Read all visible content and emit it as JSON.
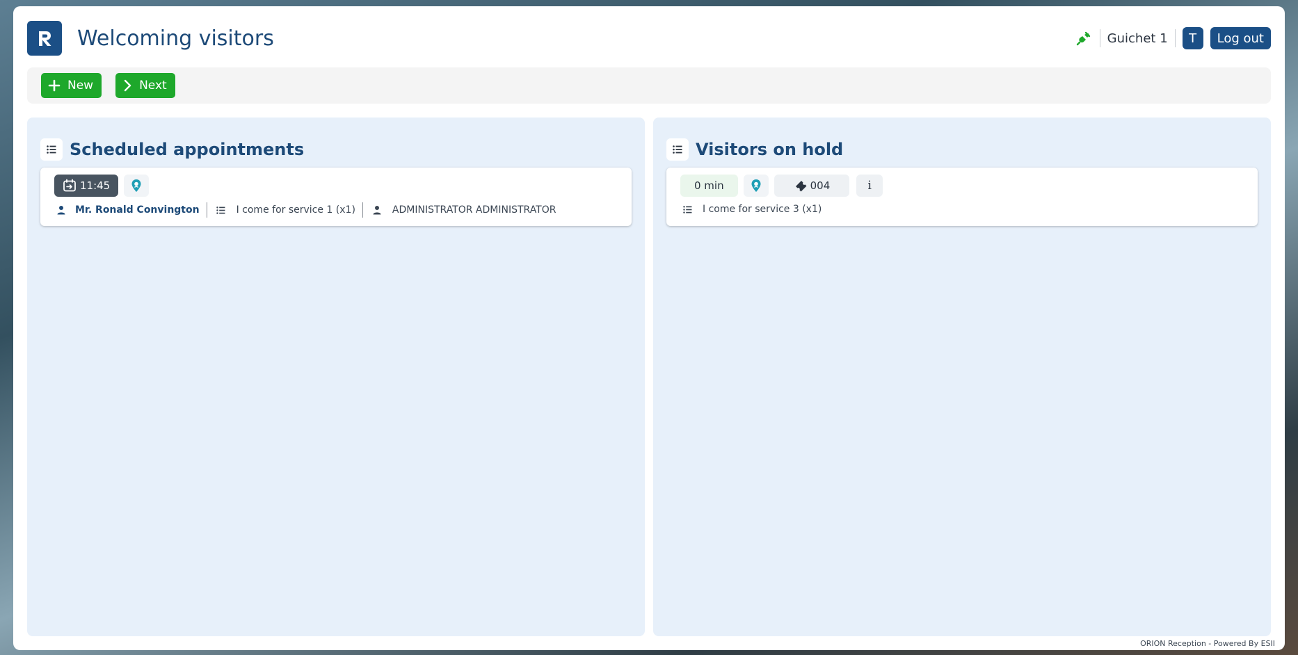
{
  "app": {
    "title": "Welcoming visitors",
    "logo_letter": "R",
    "brand_color": "#1b4f86",
    "accent_green": "#1ea82b"
  },
  "header": {
    "connection_icon": "plug-connected-icon",
    "counter_label": "Guichet 1",
    "user_initial": "T",
    "logout_label": "Log out"
  },
  "toolbar": {
    "new_label": "New",
    "next_label": "Next"
  },
  "scheduled": {
    "title": "Scheduled appointments",
    "appointments": [
      {
        "time": "11:45",
        "visitor": "Mr. Ronald Convington",
        "service": "I come for service 1  (x1)",
        "agent": "ADMINISTRATOR ADMINISTRATOR"
      }
    ]
  },
  "on_hold": {
    "title": "Visitors on hold",
    "visitors": [
      {
        "wait": "0  min",
        "ticket": "004",
        "info": "i",
        "service": "I come for service 3  (x1)"
      }
    ]
  },
  "footer": {
    "text": "ORION Reception - Powered By ESII"
  }
}
